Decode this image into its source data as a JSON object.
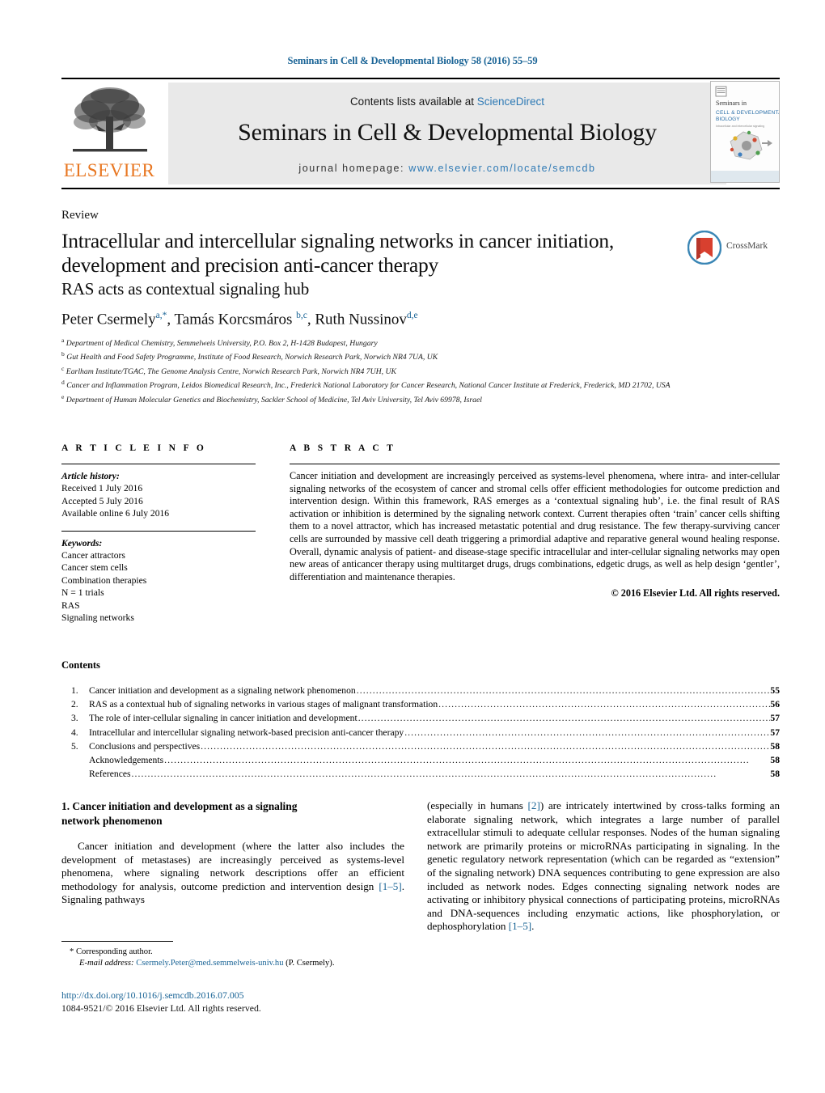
{
  "running_head": "Seminars in Cell & Developmental Biology 58 (2016) 55–59",
  "masthead": {
    "contents_prefix": "Contents lists available at ",
    "sciencedirect": "ScienceDirect",
    "journal_title": "Seminars in Cell & Developmental Biology",
    "homepage_prefix": "journal homepage: ",
    "homepage_url": "www.elsevier.com/locate/semcdb",
    "publisher": "ELSEVIER",
    "cover": {
      "line1": "Seminars in",
      "line2": "CELL & DEVELOPMENTAL",
      "line3": "BIOLOGY"
    },
    "link_color": "#2f7ab5",
    "band_color": "#e9e9e9",
    "publisher_color": "#E87722"
  },
  "article": {
    "type": "Review",
    "title_line1": "Intracellular and intercellular signaling networks in cancer initiation,",
    "title_line2": "development and precision anti-cancer therapy",
    "subtitle": "RAS acts as contextual signaling hub",
    "crossmark_label": "CrossMark"
  },
  "authors": {
    "list": "Peter Csermely",
    "a1_sup": "a,*",
    "author2": ", Tamás Korcsmáros ",
    "a2_sup": "b,c",
    "author3": ", Ruth Nussinov",
    "a3_sup": "d,e",
    "affiliations": [
      {
        "sup": "a",
        "text": "Department of Medical Chemistry, Semmelweis University, P.O. Box 2, H-1428 Budapest, Hungary"
      },
      {
        "sup": "b",
        "text": "Gut Health and Food Safety Programme, Institute of Food Research, Norwich Research Park, Norwich NR4 7UA, UK"
      },
      {
        "sup": "c",
        "text": "Earlham Institute/TGAC, The Genome Analysis Centre, Norwich Research Park, Norwich NR4 7UH, UK"
      },
      {
        "sup": "d",
        "text": "Cancer and Inflammation Program, Leidos Biomedical Research, Inc., Frederick National Laboratory for Cancer Research, National Cancer Institute at Frederick, Frederick, MD 21702, USA"
      },
      {
        "sup": "e",
        "text": "Department of Human Molecular Genetics and Biochemistry, Sackler School of Medicine, Tel Aviv University, Tel Aviv 69978, Israel"
      }
    ]
  },
  "article_info": {
    "heading": "A R T I C L E   I N F O",
    "history_label": "Article history:",
    "history": [
      "Received 1 July 2016",
      "Accepted 5 July 2016",
      "Available online 6 July 2016"
    ],
    "keywords_label": "Keywords:",
    "keywords": [
      "Cancer attractors",
      "Cancer stem cells",
      "Combination therapies",
      "N = 1 trials",
      "RAS",
      "Signaling networks"
    ]
  },
  "abstract": {
    "heading": "A B S T R A C T",
    "text": "Cancer initiation and development are increasingly perceived as systems-level phenomena, where intra- and inter-cellular signaling networks of the ecosystem of cancer and stromal cells offer efficient methodologies for outcome prediction and intervention design. Within this framework, RAS emerges as a ‘contextual signaling hub’, i.e. the final result of RAS activation or inhibition is determined by the signaling network context. Current therapies often ‘train’ cancer cells shifting them to a novel attractor, which has increased metastatic potential and drug resistance. The few therapy-surviving cancer cells are surrounded by massive cell death triggering a primordial adaptive and reparative general wound healing response. Overall, dynamic analysis of patient- and disease-stage specific intracellular and inter-cellular signaling networks may open new areas of anticancer therapy using multitarget drugs, drugs combinations, edgetic drugs, as well as help design ‘gentler’, differentiation and maintenance therapies.",
    "copyright": "© 2016 Elsevier Ltd. All rights reserved."
  },
  "contents": {
    "heading": "Contents",
    "entries": [
      {
        "num": "1.",
        "label": "Cancer initiation and development as a signaling network phenomenon",
        "page": "55"
      },
      {
        "num": "2.",
        "label": "RAS as a contextual hub of signaling networks in various stages of malignant transformation ",
        "page": "56"
      },
      {
        "num": "3.",
        "label": "The role of inter-cellular signaling in cancer initiation and development",
        "page": "57"
      },
      {
        "num": "4.",
        "label": "Intracellular and intercellular signaling network-based precision anti-cancer therapy ",
        "page": "57"
      },
      {
        "num": "5.",
        "label": "Conclusions and perspectives ",
        "page": "58"
      },
      {
        "num": "",
        "label": "Acknowledgements",
        "page": "58"
      },
      {
        "num": "",
        "label": "References ",
        "page": "58"
      }
    ]
  },
  "body": {
    "section_number": "1.",
    "section_title_line1": "Cancer initiation and development as a signaling",
    "section_title_line2": "network phenomenon",
    "left_para_a": "Cancer initiation and development (where the latter also includes the development of metastases) are increasingly perceived as systems-level phenomena, where signaling network descriptions offer an efficient methodology for analysis, outcome prediction and intervention design ",
    "left_ref_1": "[1–5]",
    "left_para_b": ". Signaling pathways",
    "right_para_a": "(especially in humans ",
    "right_ref_1": "[2]",
    "right_para_b": ") are intricately intertwined by cross-talks forming an elaborate signaling network, which integrates a large number of parallel extracellular stimuli to adequate cellular responses. Nodes of the human signaling network are primarily proteins or microRNAs participating in signaling. In the genetic regulatory network representation (which can be regarded as “extension” of the signaling network) DNA sequences contributing to gene expression are also included as network nodes. Edges connecting signaling network nodes are activating or inhibitory physical connections of participating proteins, microRNAs and DNA-sequences including enzymatic actions, like phosphorylation, or dephosphorylation ",
    "right_ref_2": "[1–5]",
    "right_para_c": "."
  },
  "footer": {
    "corresponding_marker": "*",
    "corresponding_label": "Corresponding author.",
    "email_label": "E-mail address:",
    "email": "Csermely.Peter@med.semmelweis-univ.hu",
    "email_owner": "(P. Csermely).",
    "doi": "http://dx.doi.org/10.1016/j.semcdb.2016.07.005",
    "issn_copyright": "1084-9521/© 2016 Elsevier Ltd. All rights reserved."
  }
}
